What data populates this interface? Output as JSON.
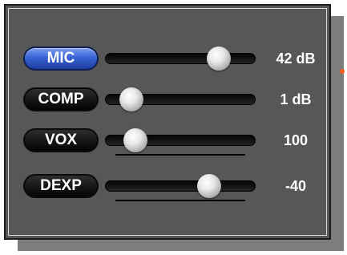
{
  "controls": [
    {
      "label": "MIC",
      "value": "42 dB",
      "active": true,
      "level": 0.79,
      "underline": false
    },
    {
      "label": "COMP",
      "value": "1 dB",
      "active": false,
      "level": 0.13,
      "underline": false
    },
    {
      "label": "VOX",
      "value": "100",
      "active": false,
      "level": 0.16,
      "underline": true
    },
    {
      "label": "DEXP",
      "value": "-40",
      "active": false,
      "level": 0.72,
      "underline": true
    }
  ],
  "colors": {
    "panel": "#575757",
    "active_button": "#3863d6",
    "accent_dot": "#f25a1d"
  }
}
